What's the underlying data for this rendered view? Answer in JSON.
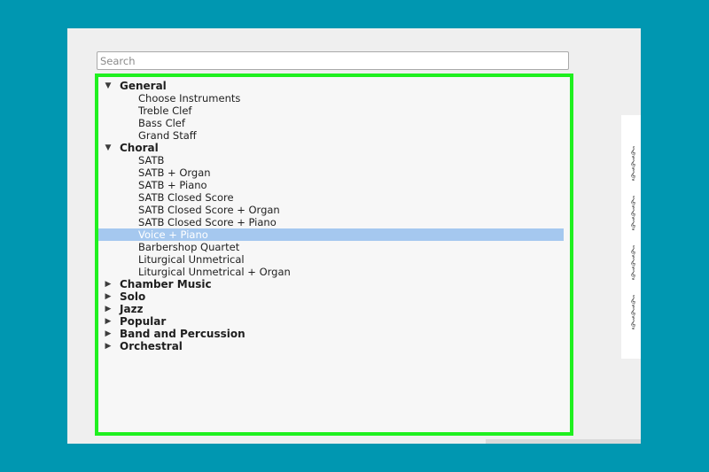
{
  "search": {
    "placeholder": "Search"
  },
  "tree": [
    {
      "label": "General",
      "expanded": true,
      "items": [
        {
          "label": "Choose Instruments"
        },
        {
          "label": "Treble Clef"
        },
        {
          "label": "Bass Clef"
        },
        {
          "label": "Grand Staff"
        }
      ]
    },
    {
      "label": "Choral",
      "expanded": true,
      "items": [
        {
          "label": "SATB"
        },
        {
          "label": "SATB + Organ"
        },
        {
          "label": "SATB + Piano"
        },
        {
          "label": "SATB Closed Score"
        },
        {
          "label": "SATB Closed Score + Organ"
        },
        {
          "label": "SATB Closed Score + Piano"
        },
        {
          "label": "Voice + Piano",
          "selected": true
        },
        {
          "label": "Barbershop Quartet"
        },
        {
          "label": "Liturgical Unmetrical"
        },
        {
          "label": "Liturgical Unmetrical + Organ"
        }
      ]
    },
    {
      "label": "Chamber Music",
      "expanded": false,
      "items": []
    },
    {
      "label": "Solo",
      "expanded": false,
      "items": []
    },
    {
      "label": "Jazz",
      "expanded": false,
      "items": []
    },
    {
      "label": "Popular",
      "expanded": false,
      "items": []
    },
    {
      "label": "Band and Percussion",
      "expanded": false,
      "items": []
    },
    {
      "label": "Orchestral",
      "expanded": false,
      "items": []
    }
  ],
  "icons": {
    "expanded": "triangle-down-icon",
    "collapsed": "triangle-right-icon",
    "score_preview": "treble-clef-icon"
  },
  "colors": {
    "background": "#0097b1",
    "highlight_border": "#1ff01f",
    "selection": "#a5c8ef"
  }
}
